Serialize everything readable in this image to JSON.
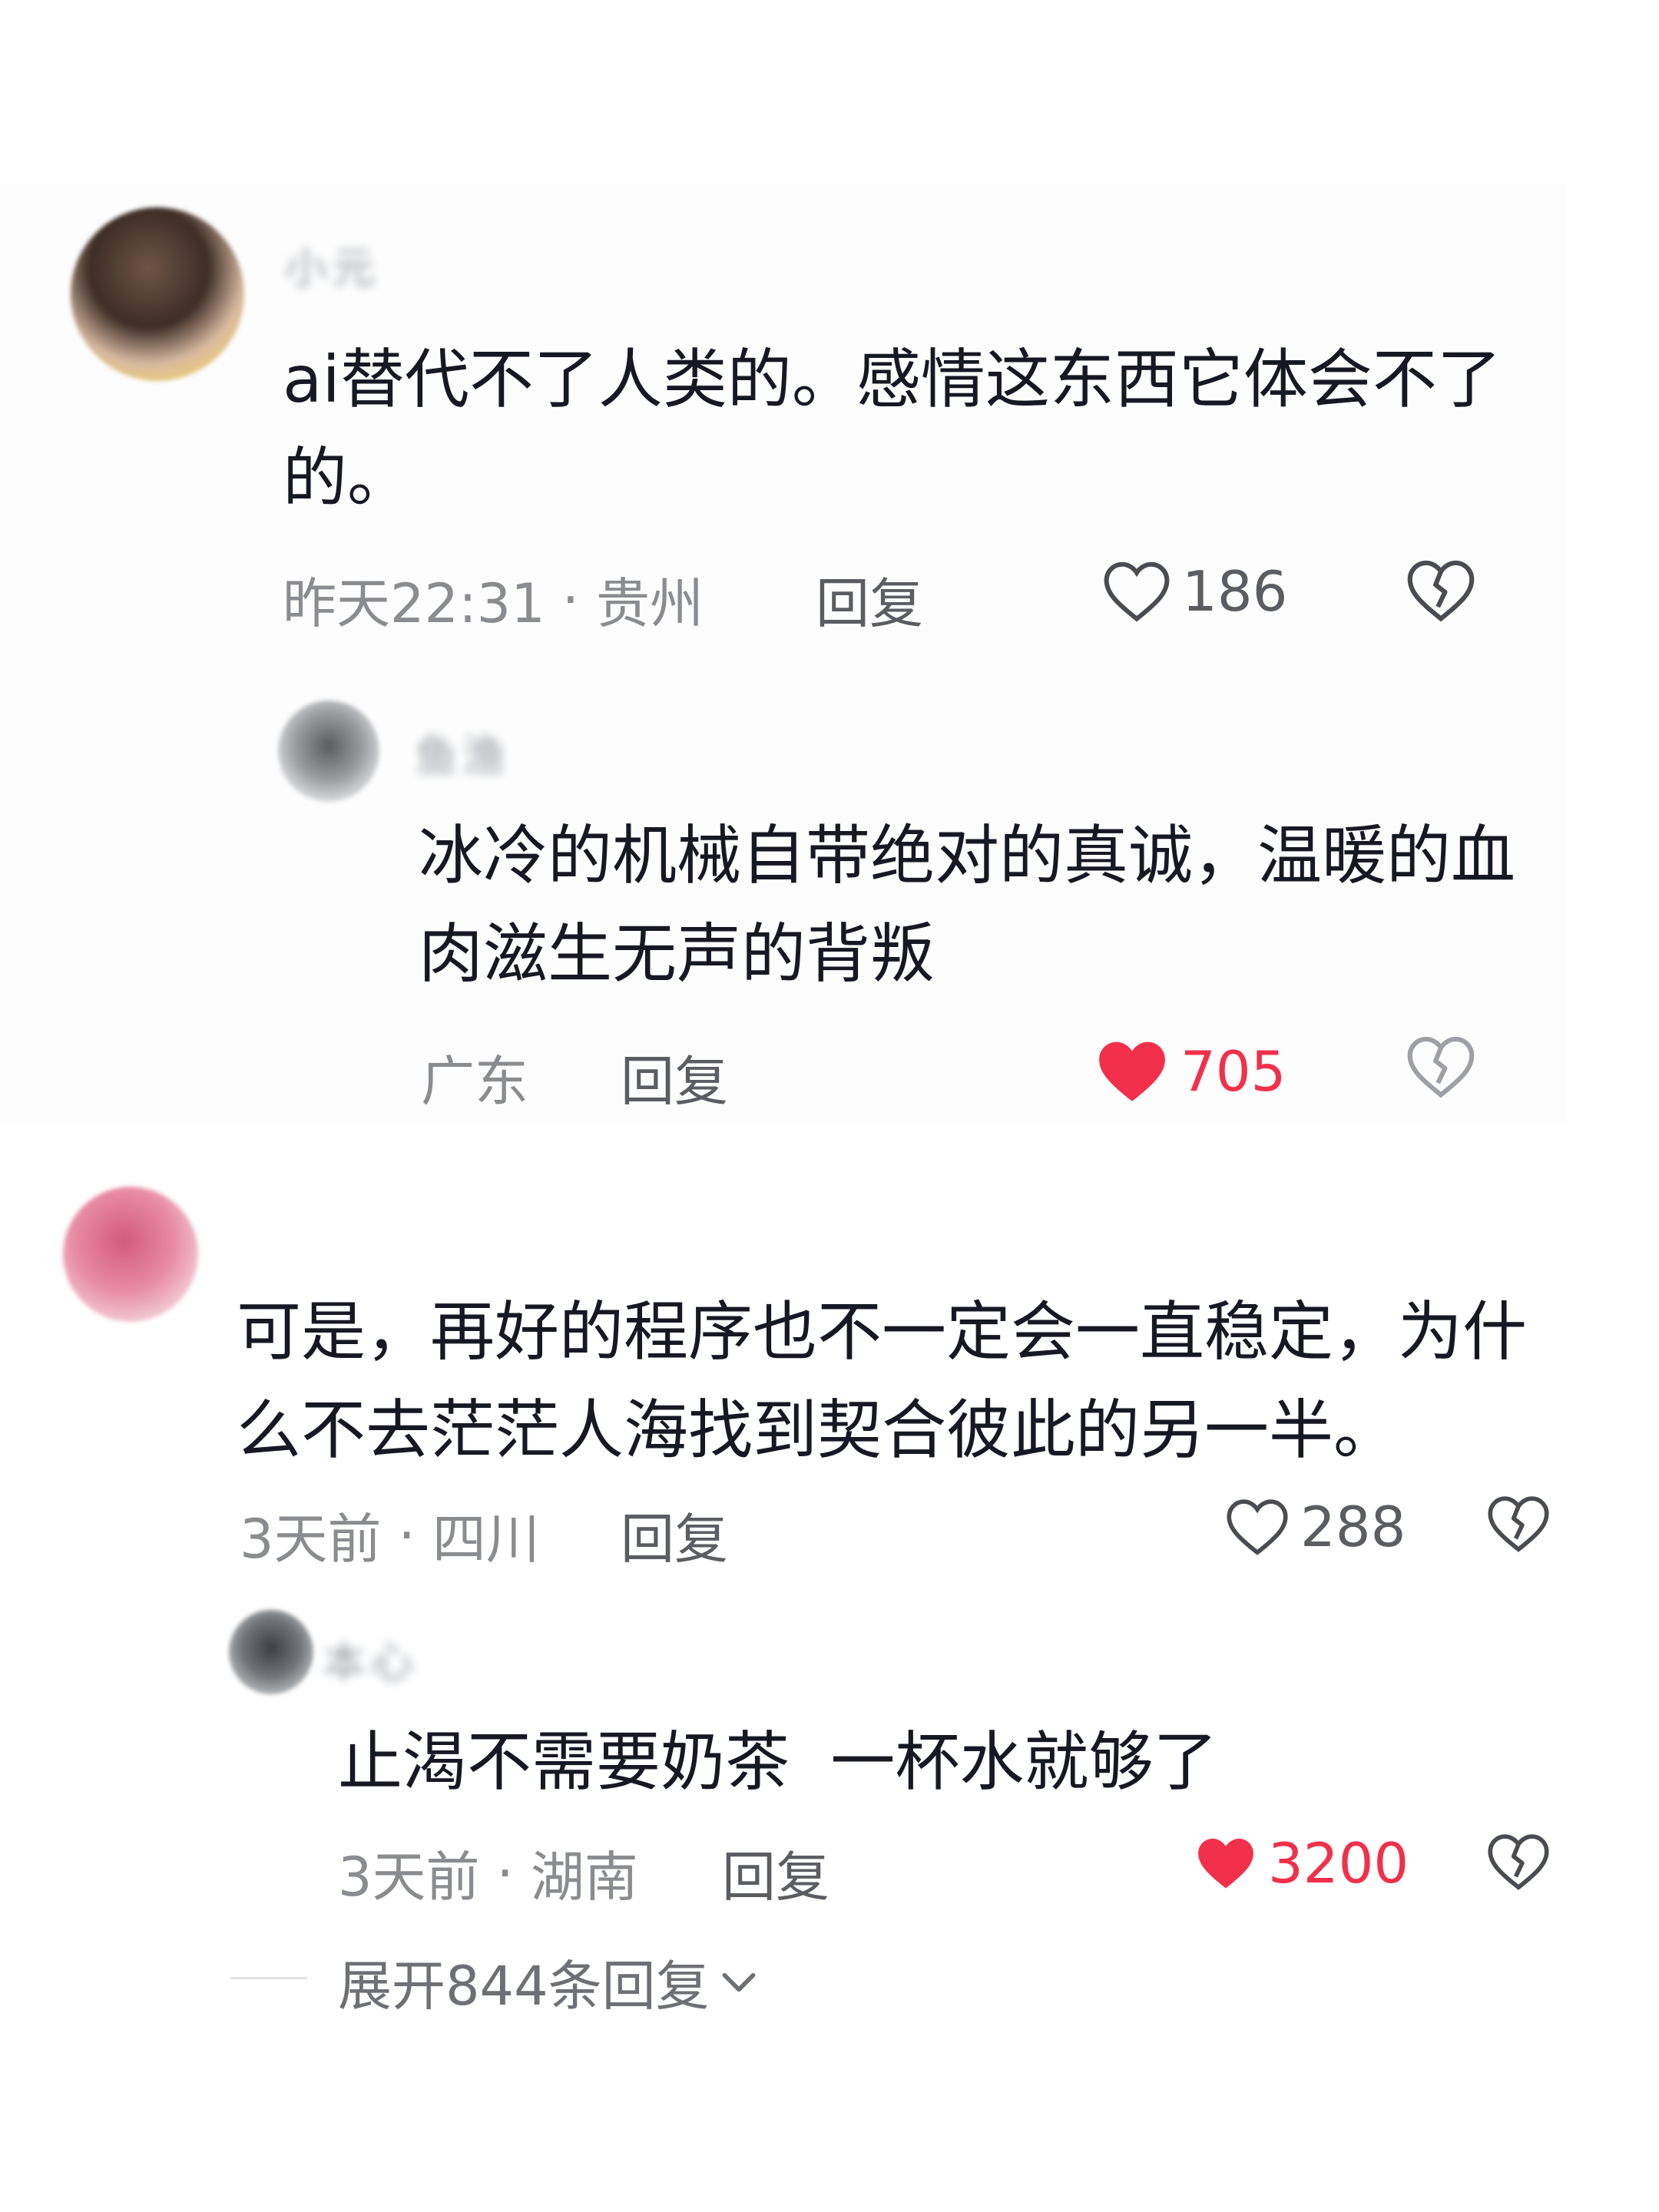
{
  "comments": [
    {
      "username": "小元",
      "text": "ai替代不了人类的。感情这东西它体会不了的。",
      "time": "昨天22:31",
      "location": "贵州",
      "reply_label": "回复",
      "likes": "186",
      "liked": false,
      "replies": [
        {
          "username": "鱼渔",
          "text": "冰冷的机械自带绝对的真诚，温暖的血肉滋生无声的背叛",
          "location": "广东",
          "reply_label": "回复",
          "likes": "705",
          "liked": true
        }
      ]
    },
    {
      "username": "",
      "text": "可是，再好的程序也不一定会一直稳定，为什么不去茫茫人海找到契合彼此的另一半。",
      "time": "3天前",
      "location": "四川",
      "reply_label": "回复",
      "likes": "288",
      "liked": false,
      "replies": [
        {
          "username": "本心",
          "text": "止渴不需要奶茶  一杯水就够了",
          "time": "3天前",
          "location": "湖南",
          "reply_label": "回复",
          "likes": "3200",
          "liked": true
        }
      ],
      "expand_label": "展开844条回复"
    }
  ],
  "colors": {
    "like_red": "#f2304b",
    "meta_gray": "#8a8c90",
    "text": "#161823"
  },
  "icons": [
    "heart-outline-icon",
    "heart-filled-icon",
    "broken-heart-icon",
    "chevron-down-icon"
  ]
}
